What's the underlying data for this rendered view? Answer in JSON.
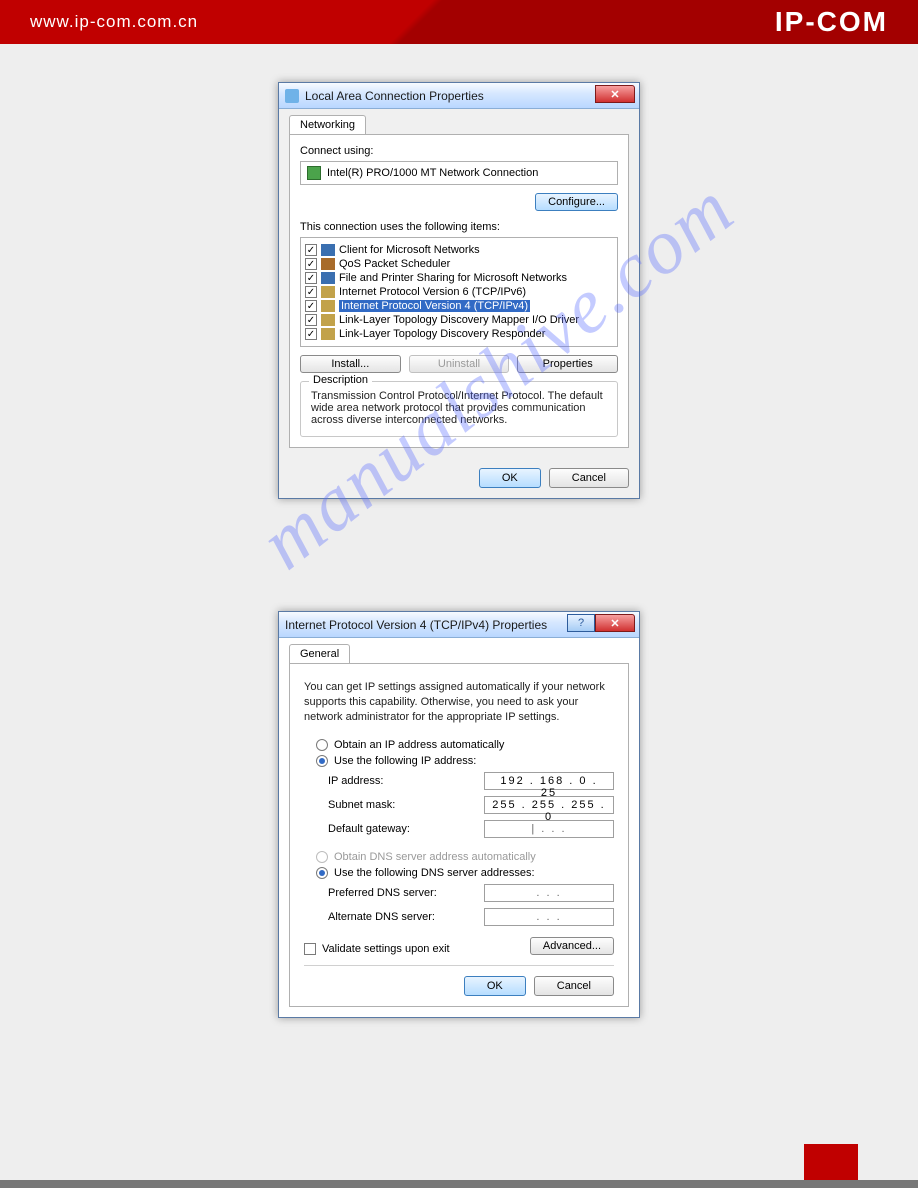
{
  "header": {
    "url": "www.ip-com.com.cn",
    "brand": "IP-COM"
  },
  "watermark": "manualshive.com",
  "dlg1": {
    "title": "Local Area Connection Properties",
    "tab": "Networking",
    "connect_using": "Connect using:",
    "nic": "Intel(R) PRO/1000 MT Network Connection",
    "configure": "Configure...",
    "items_label": "This connection uses the following items:",
    "items": [
      {
        "label": "Client for Microsoft Networks",
        "checked": true,
        "icon": "net"
      },
      {
        "label": "QoS Packet Scheduler",
        "checked": true,
        "icon": "qos"
      },
      {
        "label": "File and Printer Sharing for Microsoft Networks",
        "checked": true,
        "icon": "net"
      },
      {
        "label": "Internet Protocol Version 6 (TCP/IPv6)",
        "checked": true,
        "icon": "proto"
      },
      {
        "label": "Internet Protocol Version 4 (TCP/IPv4)",
        "checked": true,
        "icon": "proto",
        "selected": true
      },
      {
        "label": "Link-Layer Topology Discovery Mapper I/O Driver",
        "checked": true,
        "icon": "proto"
      },
      {
        "label": "Link-Layer Topology Discovery Responder",
        "checked": true,
        "icon": "proto"
      }
    ],
    "install": "Install...",
    "uninstall": "Uninstall",
    "properties": "Properties",
    "desc_group": "Description",
    "desc_text": "Transmission Control Protocol/Internet Protocol. The default wide area network protocol that provides communication across diverse interconnected networks.",
    "ok": "OK",
    "cancel": "Cancel"
  },
  "dlg2": {
    "title": "Internet Protocol Version 4 (TCP/IPv4) Properties",
    "tab": "General",
    "instr": "You can get IP settings assigned automatically if your network supports this capability. Otherwise, you need to ask your network administrator for the appropriate IP settings.",
    "opt_auto_ip": "Obtain an IP address automatically",
    "opt_static_ip": "Use the following IP address:",
    "ip_label": "IP address:",
    "ip_value": "192 . 168 .  0  . 25",
    "subnet_label": "Subnet mask:",
    "subnet_value": "255 . 255 . 255 .  0",
    "gw_label": "Default gateway:",
    "gw_value": "|    .      .     .",
    "opt_auto_dns": "Obtain DNS server address automatically",
    "opt_static_dns": "Use the following DNS server addresses:",
    "pref_dns_label": "Preferred DNS server:",
    "pref_dns_value": ".      .     .",
    "alt_dns_label": "Alternate DNS server:",
    "alt_dns_value": ".      .     .",
    "validate": "Validate settings upon exit",
    "advanced": "Advanced...",
    "ok": "OK",
    "cancel": "Cancel"
  }
}
